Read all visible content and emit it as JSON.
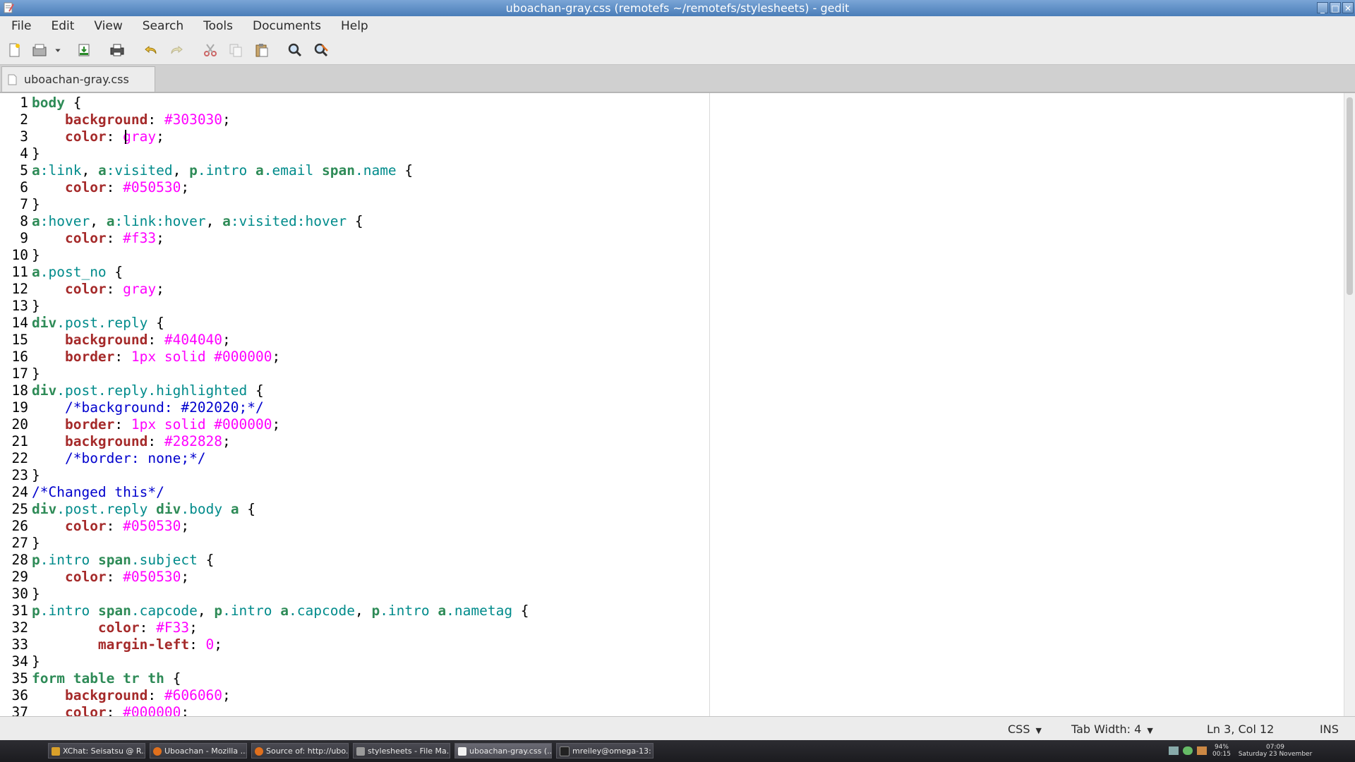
{
  "window": {
    "title": "uboachan-gray.css (remotefs ~/remotefs/stylesheets) - gedit",
    "buttons": {
      "minimize": "_",
      "maximize": "□",
      "close": "✕"
    }
  },
  "menu": [
    "File",
    "Edit",
    "View",
    "Search",
    "Tools",
    "Documents",
    "Help"
  ],
  "toolbar": {
    "icons": [
      "new-document-icon",
      "open-folder-icon",
      "open-dropdown-icon",
      "save-icon",
      "print-icon",
      "undo-icon",
      "redo-icon",
      "cut-icon",
      "copy-icon",
      "paste-icon",
      "find-icon",
      "find-replace-icon"
    ]
  },
  "tab": {
    "label": "uboachan-gray.css"
  },
  "editor": {
    "lines": [
      [
        [
          "s",
          "body"
        ],
        [
          "x",
          " {"
        ]
      ],
      [
        [
          "x",
          "    "
        ],
        [
          "p",
          "background"
        ],
        [
          "x",
          ": "
        ],
        [
          "v",
          "#303030"
        ],
        [
          "x",
          ";"
        ]
      ],
      [
        [
          "x",
          "    "
        ],
        [
          "p",
          "color"
        ],
        [
          "x",
          ": "
        ],
        [
          "v",
          "gray"
        ],
        [
          "x",
          ";"
        ]
      ],
      [
        [
          "x",
          "}"
        ]
      ],
      [
        [
          "s",
          "a"
        ],
        [
          "c",
          ":link"
        ],
        [
          "x",
          ", "
        ],
        [
          "s",
          "a"
        ],
        [
          "c",
          ":visited"
        ],
        [
          "x",
          ", "
        ],
        [
          "s",
          "p"
        ],
        [
          "c",
          ".intro"
        ],
        [
          "x",
          " "
        ],
        [
          "s",
          "a"
        ],
        [
          "c",
          ".email"
        ],
        [
          "x",
          " "
        ],
        [
          "s",
          "span"
        ],
        [
          "c",
          ".name"
        ],
        [
          "x",
          " {"
        ]
      ],
      [
        [
          "x",
          "    "
        ],
        [
          "p",
          "color"
        ],
        [
          "x",
          ": "
        ],
        [
          "v",
          "#050530"
        ],
        [
          "x",
          ";"
        ]
      ],
      [
        [
          "x",
          "}"
        ]
      ],
      [
        [
          "s",
          "a"
        ],
        [
          "c",
          ":hover"
        ],
        [
          "x",
          ", "
        ],
        [
          "s",
          "a"
        ],
        [
          "c",
          ":link:hover"
        ],
        [
          "x",
          ", "
        ],
        [
          "s",
          "a"
        ],
        [
          "c",
          ":visited:hover"
        ],
        [
          "x",
          " {"
        ]
      ],
      [
        [
          "x",
          "    "
        ],
        [
          "p",
          "color"
        ],
        [
          "x",
          ": "
        ],
        [
          "v",
          "#f33"
        ],
        [
          "x",
          ";"
        ]
      ],
      [
        [
          "x",
          "}"
        ]
      ],
      [
        [
          "s",
          "a"
        ],
        [
          "c",
          ".post_no"
        ],
        [
          "x",
          " {"
        ]
      ],
      [
        [
          "x",
          "    "
        ],
        [
          "p",
          "color"
        ],
        [
          "x",
          ": "
        ],
        [
          "v",
          "gray"
        ],
        [
          "x",
          ";"
        ]
      ],
      [
        [
          "x",
          "}"
        ]
      ],
      [
        [
          "s",
          "div"
        ],
        [
          "c",
          ".post.reply"
        ],
        [
          "x",
          " {"
        ]
      ],
      [
        [
          "x",
          "    "
        ],
        [
          "p",
          "background"
        ],
        [
          "x",
          ": "
        ],
        [
          "v",
          "#404040"
        ],
        [
          "x",
          ";"
        ]
      ],
      [
        [
          "x",
          "    "
        ],
        [
          "p",
          "border"
        ],
        [
          "x",
          ": "
        ],
        [
          "v",
          "1px solid #000000"
        ],
        [
          "x",
          ";"
        ]
      ],
      [
        [
          "x",
          "}"
        ]
      ],
      [
        [
          "s",
          "div"
        ],
        [
          "c",
          ".post.reply.highlighted"
        ],
        [
          "x",
          " {"
        ]
      ],
      [
        [
          "x",
          "    "
        ],
        [
          "m",
          "/*background: #202020;*/"
        ]
      ],
      [
        [
          "x",
          "    "
        ],
        [
          "p",
          "border"
        ],
        [
          "x",
          ": "
        ],
        [
          "v",
          "1px solid #000000"
        ],
        [
          "x",
          ";"
        ]
      ],
      [
        [
          "x",
          "    "
        ],
        [
          "p",
          "background"
        ],
        [
          "x",
          ": "
        ],
        [
          "v",
          "#282828"
        ],
        [
          "x",
          ";"
        ]
      ],
      [
        [
          "x",
          "    "
        ],
        [
          "m",
          "/*border: none;*/"
        ]
      ],
      [
        [
          "x",
          "}"
        ]
      ],
      [
        [
          "m",
          "/*Changed this*/"
        ]
      ],
      [
        [
          "s",
          "div"
        ],
        [
          "c",
          ".post.reply"
        ],
        [
          "x",
          " "
        ],
        [
          "s",
          "div"
        ],
        [
          "c",
          ".body"
        ],
        [
          "x",
          " "
        ],
        [
          "s",
          "a"
        ],
        [
          "x",
          " {"
        ]
      ],
      [
        [
          "x",
          "    "
        ],
        [
          "p",
          "color"
        ],
        [
          "x",
          ": "
        ],
        [
          "v",
          "#050530"
        ],
        [
          "x",
          ";"
        ]
      ],
      [
        [
          "x",
          "}"
        ]
      ],
      [
        [
          "s",
          "p"
        ],
        [
          "c",
          ".intro"
        ],
        [
          "x",
          " "
        ],
        [
          "s",
          "span"
        ],
        [
          "c",
          ".subject"
        ],
        [
          "x",
          " {"
        ]
      ],
      [
        [
          "x",
          "    "
        ],
        [
          "p",
          "color"
        ],
        [
          "x",
          ": "
        ],
        [
          "v",
          "#050530"
        ],
        [
          "x",
          ";"
        ]
      ],
      [
        [
          "x",
          "}"
        ]
      ],
      [
        [
          "s",
          "p"
        ],
        [
          "c",
          ".intro"
        ],
        [
          "x",
          " "
        ],
        [
          "s",
          "span"
        ],
        [
          "c",
          ".capcode"
        ],
        [
          "x",
          ", "
        ],
        [
          "s",
          "p"
        ],
        [
          "c",
          ".intro"
        ],
        [
          "x",
          " "
        ],
        [
          "s",
          "a"
        ],
        [
          "c",
          ".capcode"
        ],
        [
          "x",
          ", "
        ],
        [
          "s",
          "p"
        ],
        [
          "c",
          ".intro"
        ],
        [
          "x",
          " "
        ],
        [
          "s",
          "a"
        ],
        [
          "c",
          ".nametag"
        ],
        [
          "x",
          " {"
        ]
      ],
      [
        [
          "x",
          "        "
        ],
        [
          "p",
          "color"
        ],
        [
          "x",
          ": "
        ],
        [
          "v",
          "#F33"
        ],
        [
          "x",
          ";"
        ]
      ],
      [
        [
          "x",
          "        "
        ],
        [
          "p",
          "margin-left"
        ],
        [
          "x",
          ": "
        ],
        [
          "v",
          "0"
        ],
        [
          "x",
          ";"
        ]
      ],
      [
        [
          "x",
          "}"
        ]
      ],
      [
        [
          "s",
          "form"
        ],
        [
          "x",
          " "
        ],
        [
          "s",
          "table"
        ],
        [
          "x",
          " "
        ],
        [
          "s",
          "tr"
        ],
        [
          "x",
          " "
        ],
        [
          "s",
          "th"
        ],
        [
          "x",
          " {"
        ]
      ],
      [
        [
          "x",
          "    "
        ],
        [
          "p",
          "background"
        ],
        [
          "x",
          ": "
        ],
        [
          "v",
          "#606060"
        ],
        [
          "x",
          ";"
        ]
      ],
      [
        [
          "x",
          "    "
        ],
        [
          "p",
          "color"
        ],
        [
          "x",
          ": "
        ],
        [
          "v",
          "#000000"
        ],
        [
          "x",
          ";"
        ]
      ]
    ]
  },
  "status": {
    "language": "CSS",
    "tab_width_label": "Tab Width:",
    "tab_width": "4",
    "position": "Ln 3, Col 12",
    "mode": "INS"
  },
  "taskbar": {
    "tasks": [
      "XChat: Seisatsu @ R...",
      "Uboachan - Mozilla ...",
      "Source of: http://ubo...",
      "stylesheets - File Ma...",
      "uboachan-gray.css (...",
      "mreiley@omega-13: ..."
    ],
    "battery_pct": "94%",
    "battery_time": "00:15",
    "clock": "07:09",
    "date": "Saturday 23 November"
  },
  "colors": {
    "selector": "#2e8b57",
    "class": "#008b8b",
    "property": "#a52a2a",
    "value": "#ff00ff",
    "comment": "#0000cd"
  }
}
